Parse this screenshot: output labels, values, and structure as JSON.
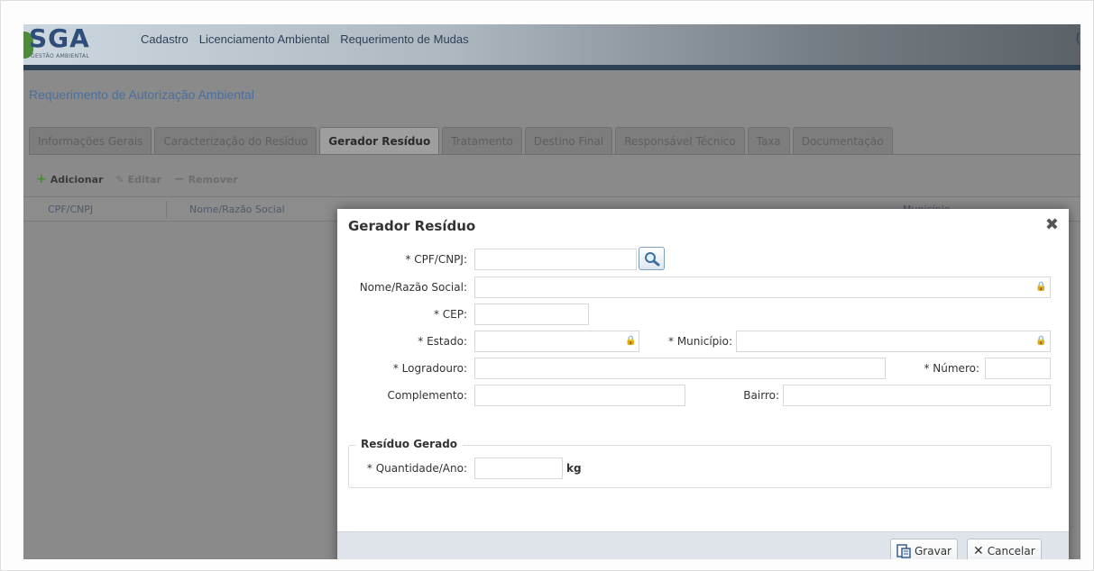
{
  "app": {
    "logo_text": "SGA",
    "logo_subtitle": "GESTÃO AMBIENTAL",
    "nav": [
      "Cadastro",
      "Licenciamento Ambiental",
      "Requerimento de Mudas"
    ],
    "corner_mark": "("
  },
  "page": {
    "title": "Requerimento de Autorização Ambiental"
  },
  "tabs": [
    {
      "label": "Informações Gerais",
      "active": false
    },
    {
      "label": "Caracterização do Resíduo",
      "active": false
    },
    {
      "label": "Gerador Resíduo",
      "active": true
    },
    {
      "label": "Tratamento",
      "active": false
    },
    {
      "label": "Destino Final",
      "active": false
    },
    {
      "label": "Responsável Técnico",
      "active": false
    },
    {
      "label": "Taxa",
      "active": false
    },
    {
      "label": "Documentação",
      "active": false
    }
  ],
  "toolbar": {
    "add": "Adicionar",
    "edit": "Editar",
    "remove": "Remover"
  },
  "grid": {
    "columns": [
      "CPF/CNPJ",
      "Nome/Razão Social",
      "Município"
    ]
  },
  "dialog": {
    "title": "Gerador Resíduo",
    "close_icon": "close-icon",
    "fields": {
      "cpf_cnpj": {
        "label": "* CPF/CNPJ:",
        "value": ""
      },
      "nome": {
        "label": "Nome/Razão Social:",
        "value": ""
      },
      "cep": {
        "label": "* CEP:",
        "value": ""
      },
      "estado": {
        "label": "* Estado:",
        "value": ""
      },
      "municipio": {
        "label": "* Município:",
        "value": ""
      },
      "logradouro": {
        "label": "* Logradouro:",
        "value": ""
      },
      "numero": {
        "label": "* Número:",
        "value": ""
      },
      "complemento": {
        "label": "Complemento:",
        "value": ""
      },
      "bairro": {
        "label": "Bairro:",
        "value": ""
      }
    },
    "residuo": {
      "legend": "Resíduo Gerado",
      "quantidade_label": "* Quantidade/Ano:",
      "quantidade_value": "",
      "unit": "kg"
    },
    "footer": {
      "save": "Gravar",
      "cancel": "Cancelar"
    }
  },
  "colors": {
    "header_bar": "#2e4153",
    "page_title": "#4a6fa0",
    "add_icon": "#4a8a2f",
    "dialog_footer": "#dfe4ea"
  }
}
